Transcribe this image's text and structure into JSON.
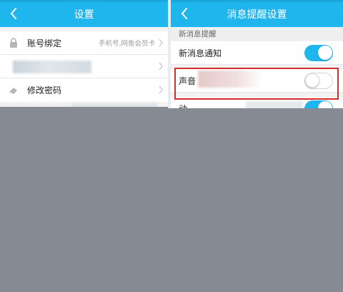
{
  "left_screen": {
    "title": "设置",
    "rows": [
      {
        "label": "账号绑定",
        "hint": "手机号,网鱼会员卡"
      },
      {
        "label": ""
      },
      {
        "label": "修改密码"
      }
    ]
  },
  "right_screen": {
    "title": "消息提醒设置",
    "section_title": "新消息提醒",
    "rows": [
      {
        "label": "新消息通知",
        "toggle": "on"
      },
      {
        "label": "声音",
        "toggle": "off"
      },
      {
        "label": "动",
        "toggle": "on"
      }
    ]
  },
  "colors": {
    "accent": "#1fb6ee",
    "highlight": "#d42b2b",
    "overlay": "#868a93"
  },
  "icons": {
    "back": "chevron-left-icon",
    "lock": "lock-icon",
    "eraser": "eraser-icon",
    "chevron": "chevron-right-icon"
  }
}
